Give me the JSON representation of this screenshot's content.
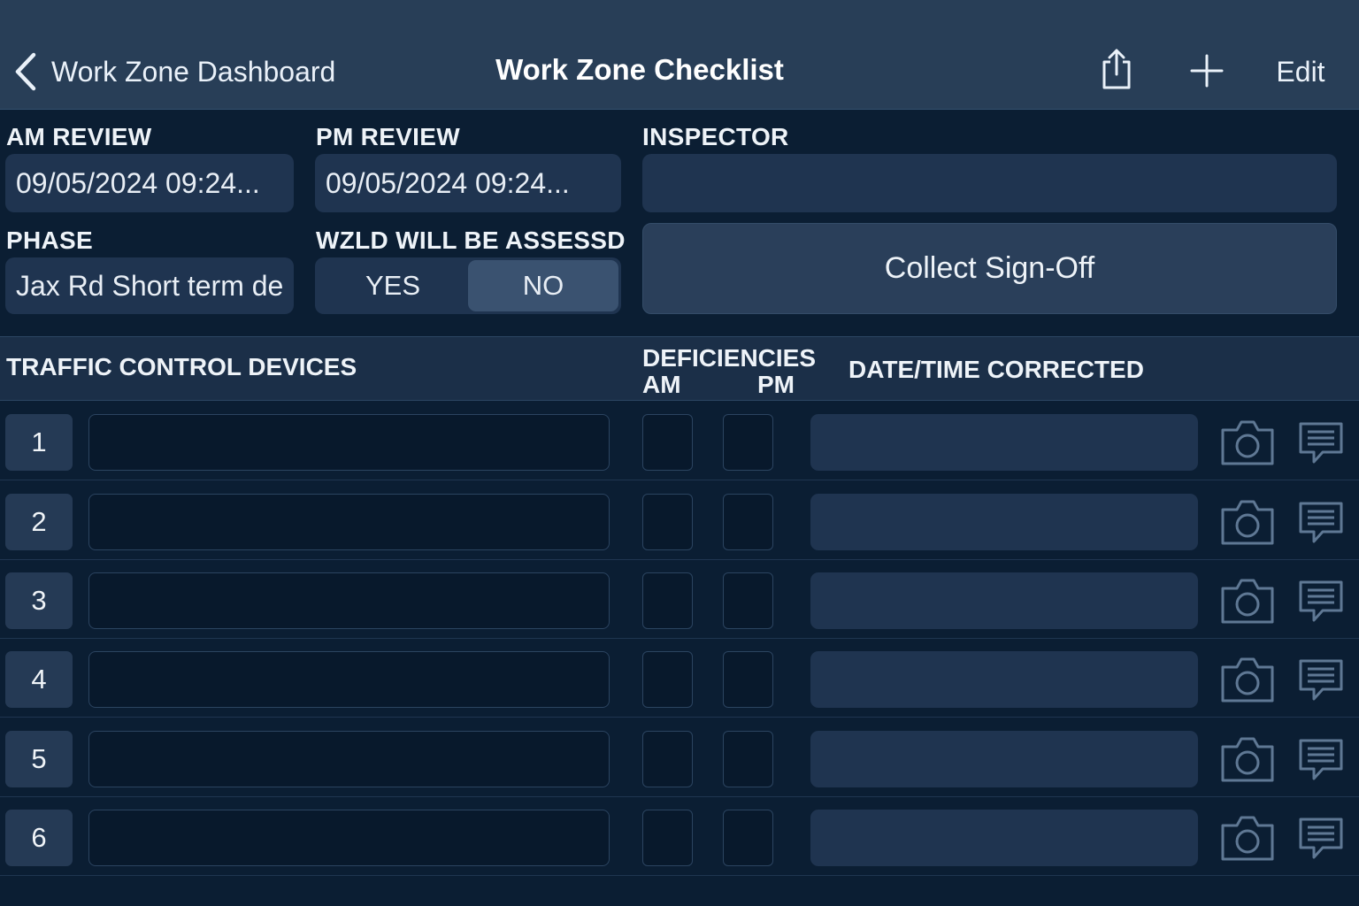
{
  "nav": {
    "back_label": "Work Zone Dashboard",
    "title": "Work Zone Checklist",
    "share_icon": "share-icon",
    "add_icon": "plus-icon",
    "edit_label": "Edit"
  },
  "form": {
    "am_review": {
      "label": "AM REVIEW",
      "value": "09/05/2024 09:24..."
    },
    "pm_review": {
      "label": "PM REVIEW",
      "value": "09/05/2024 09:24..."
    },
    "inspector": {
      "label": "INSPECTOR",
      "value": ""
    },
    "phase": {
      "label": "PHASE",
      "value": "Jax Rd Short term de"
    },
    "wzld": {
      "label": "WZLD WILL BE ASSESSD",
      "options": [
        "YES",
        "NO"
      ],
      "selected": "NO"
    },
    "signoff_label": "Collect Sign-Off"
  },
  "table": {
    "headers": {
      "devices": "TRAFFIC CONTROL DEVICES",
      "deficiencies": "DEFICIENCIES",
      "am": "AM",
      "pm": "PM",
      "corrected": "DATE/TIME CORRECTED"
    },
    "rows": [
      {
        "number": "1",
        "device": "",
        "am": false,
        "pm": false,
        "corrected": ""
      },
      {
        "number": "2",
        "device": "",
        "am": false,
        "pm": false,
        "corrected": ""
      },
      {
        "number": "3",
        "device": "",
        "am": false,
        "pm": false,
        "corrected": ""
      },
      {
        "number": "4",
        "device": "",
        "am": false,
        "pm": false,
        "corrected": ""
      },
      {
        "number": "5",
        "device": "",
        "am": false,
        "pm": false,
        "corrected": ""
      },
      {
        "number": "6",
        "device": "",
        "am": false,
        "pm": false,
        "corrected": ""
      }
    ],
    "row_icons": [
      "camera-icon",
      "comment-icon"
    ]
  },
  "colors": {
    "nav_bg": "#283e57",
    "page_bg": "#0b1e33",
    "field_bg": "#1f3450",
    "icon": "#5f7894"
  }
}
